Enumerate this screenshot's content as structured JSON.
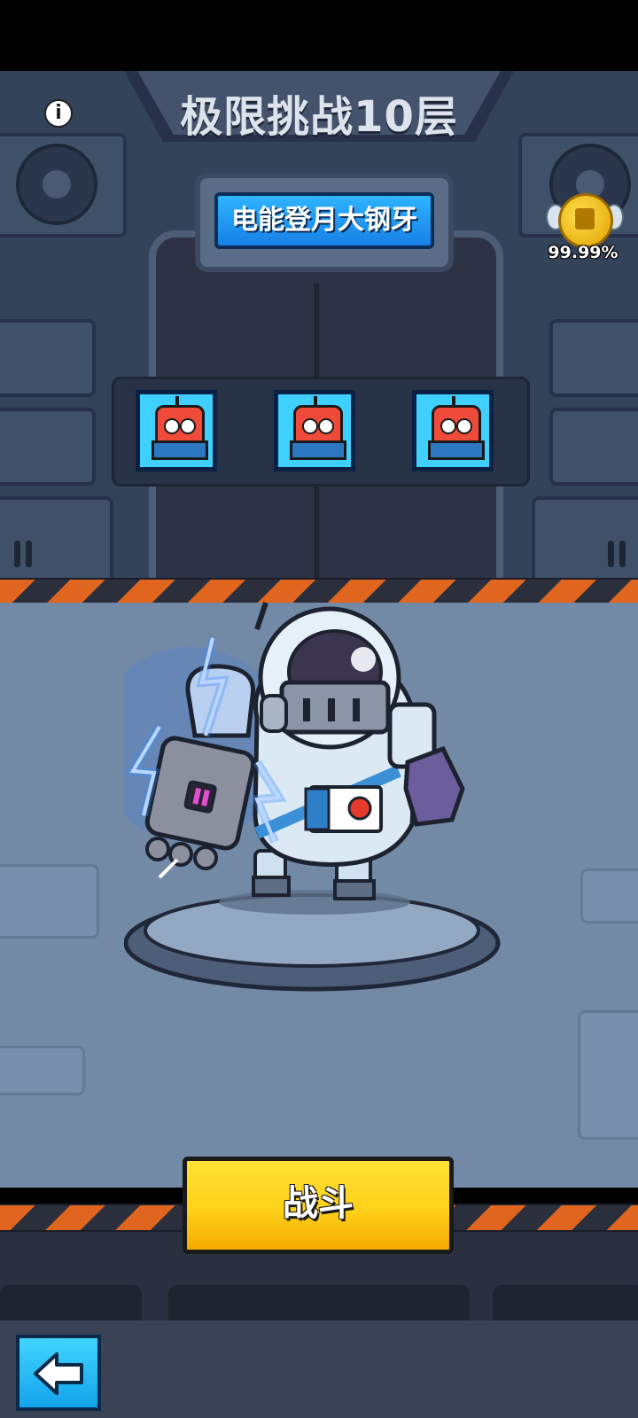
{
  "header": {
    "title": "极限挑战10层"
  },
  "boss": {
    "name": "电能登月大钢牙"
  },
  "ranking": {
    "percent": "99.99%"
  },
  "enemies": [
    {
      "name": "red-robot-enemy"
    },
    {
      "name": "red-robot-enemy"
    },
    {
      "name": "red-robot-enemy"
    }
  ],
  "actions": {
    "fight_label": "战斗"
  },
  "icons": {
    "info": "info-icon",
    "back": "back-arrow-icon",
    "trophy": "winged-coin-icon"
  },
  "colors": {
    "accent_blue": "#2fb4ff",
    "fight_yellow": "#ffd11a",
    "hazard_orange": "#e0651f"
  }
}
